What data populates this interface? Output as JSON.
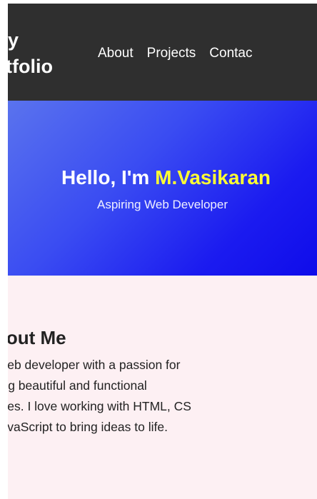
{
  "header": {
    "logo_line1": "y",
    "logo_line2": "ortfolio",
    "nav": {
      "about": "About",
      "projects": "Projects",
      "contact": "Contac"
    }
  },
  "hero": {
    "greeting": "Hello, I'm ",
    "name": "M.Vasikaran",
    "subtitle": "Aspiring Web Developer",
    "name_color": "#ffff33"
  },
  "about": {
    "heading": "bout Me",
    "lines": [
      "a web developer with a passion for",
      "ating beautiful and functional",
      "bsites. I love working with HTML, CS",
      "l JavaScript to bring ideas to life."
    ]
  }
}
